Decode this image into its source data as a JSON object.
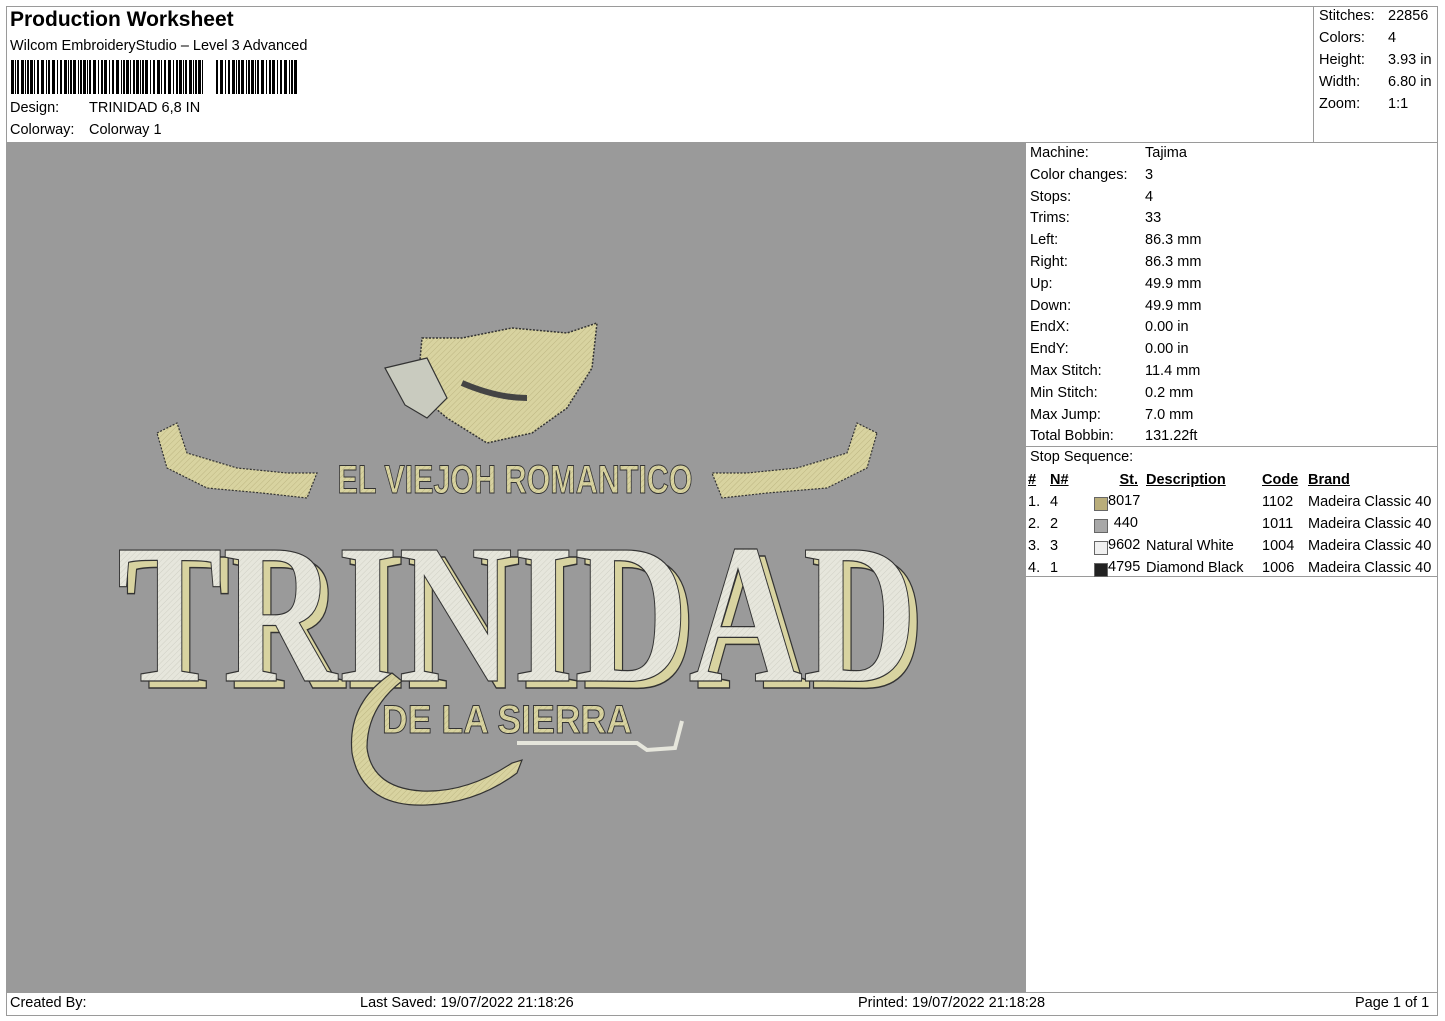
{
  "header": {
    "title": "Production Worksheet",
    "software": "Wilcom EmbroideryStudio – Level 3 Advanced",
    "design_label": "Design:",
    "design_value": "TRINIDAD 6,8 IN",
    "colorway_label": "Colorway:",
    "colorway_value": "Colorway 1"
  },
  "summary": [
    {
      "label": "Stitches:",
      "value": "22856"
    },
    {
      "label": "Colors:",
      "value": "4"
    },
    {
      "label": "Height:",
      "value": "3.93 in"
    },
    {
      "label": "Width:",
      "value": "6.80 in"
    },
    {
      "label": "Zoom:",
      "value": "1:1"
    }
  ],
  "machine_info": [
    {
      "label": "Machine:",
      "value": "Tajima"
    },
    {
      "label": "Color changes:",
      "value": "3"
    },
    {
      "label": "Stops:",
      "value": "4"
    },
    {
      "label": "Trims:",
      "value": "33"
    },
    {
      "label": "Left:",
      "value": "86.3 mm"
    },
    {
      "label": "Right:",
      "value": "86.3 mm"
    },
    {
      "label": "Up:",
      "value": "49.9 mm"
    },
    {
      "label": "Down:",
      "value": "49.9 mm"
    },
    {
      "label": "EndX:",
      "value": "0.00 in"
    },
    {
      "label": "EndY:",
      "value": "0.00 in"
    },
    {
      "label": "Max Stitch:",
      "value": "11.4 mm"
    },
    {
      "label": "Min Stitch:",
      "value": "0.2 mm"
    },
    {
      "label": "Max Jump:",
      "value": "7.0 mm"
    },
    {
      "label": "Total Bobbin:",
      "value": "131.22ft"
    }
  ],
  "stop_sequence": {
    "title": "Stop Sequence:",
    "columns": [
      "#",
      "N#",
      "St.",
      "Description",
      "Code",
      "Brand"
    ],
    "rows": [
      {
        "idx": "1.",
        "n": "4",
        "color": "#b9ad7a",
        "st": "8017",
        "desc": "",
        "code": "1102",
        "brand": "Madeira Classic 40"
      },
      {
        "idx": "2.",
        "n": "2",
        "color": "#a8a8a8",
        "st": "440",
        "desc": "",
        "code": "1011",
        "brand": "Madeira Classic 40"
      },
      {
        "idx": "3.",
        "n": "3",
        "color": "#f0f0f0",
        "st": "9602",
        "desc": "Natural White",
        "code": "1004",
        "brand": "Madeira Classic 40"
      },
      {
        "idx": "4.",
        "n": "1",
        "color": "#222222",
        "st": "4795",
        "desc": "Diamond Black",
        "code": "1006",
        "brand": "Madeira Classic 40"
      }
    ]
  },
  "design_preview": {
    "line1": "EL VIEJOH ROMANTICO",
    "line2": "TRINIDAD",
    "line3": "DE LA SIERRA",
    "thread_gold": "#d8d3a0",
    "thread_white": "#e6e6dc",
    "background": "#9a9a9a"
  },
  "footer": {
    "created_by": "Created By:",
    "last_saved": "Last Saved: 19/07/2022 21:18:26",
    "printed": "Printed: 19/07/2022 21:18:28",
    "page": "Page 1 of 1"
  }
}
